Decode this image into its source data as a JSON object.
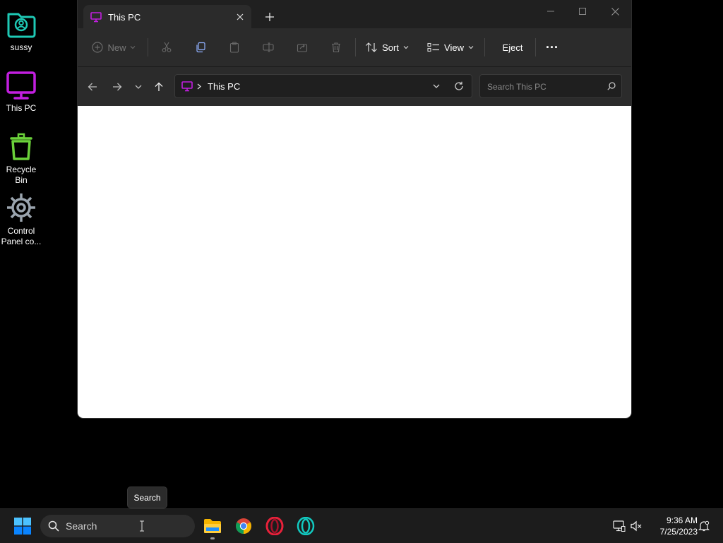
{
  "desktop": {
    "icons": [
      {
        "label": "sussy",
        "icon": "user-folder-icon",
        "color": "#1ec9b5"
      },
      {
        "label": "This PC",
        "icon": "monitor-icon",
        "color": "#c21fe0"
      },
      {
        "label": "Recycle Bin",
        "icon": "recycle-bin-icon",
        "color": "#6bd13a"
      },
      {
        "label": "Control Panel co...",
        "icon": "gear-icon",
        "color": "#9aa4ae"
      }
    ]
  },
  "window": {
    "tab_title": "This PC",
    "toolbar": {
      "new_label": "New",
      "sort_label": "Sort",
      "view_label": "View",
      "eject_label": "Eject",
      "more_label": "..."
    },
    "address": {
      "path": "This PC"
    },
    "search": {
      "placeholder": "Search This PC"
    }
  },
  "tooltip": {
    "text": "Search"
  },
  "taskbar": {
    "search_label": "Search",
    "apps": [
      "file-explorer-icon",
      "chrome-icon",
      "opera-icon",
      "opera-gx-icon"
    ],
    "clock": {
      "time": "9:36 AM",
      "date": "7/25/2023"
    }
  },
  "colors": {
    "accent_pc": "#c21fe0",
    "window_bg": "#202020",
    "toolbar_bg": "#2b2b2b",
    "windows_blue": "#0a84ff"
  }
}
